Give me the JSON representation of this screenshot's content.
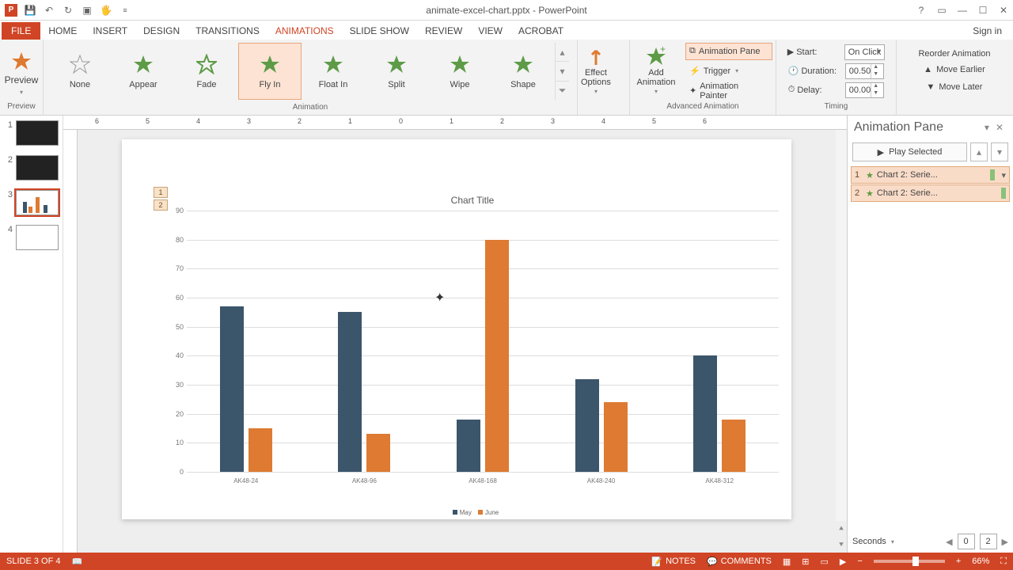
{
  "app": {
    "title": "animate-excel-chart.pptx - PowerPoint",
    "signin": "Sign in"
  },
  "tabs": {
    "file": "FILE",
    "home": "HOME",
    "insert": "INSERT",
    "design": "DESIGN",
    "transitions": "TRANSITIONS",
    "animations": "ANIMATIONS",
    "slideshow": "SLIDE SHOW",
    "review": "REVIEW",
    "view": "VIEW",
    "acrobat": "ACROBAT"
  },
  "ribbon": {
    "preview": {
      "btn": "Preview",
      "group": "Preview"
    },
    "animation": {
      "group": "Animation",
      "items": {
        "none": "None",
        "appear": "Appear",
        "fade": "Fade",
        "flyin": "Fly In",
        "floatin": "Float In",
        "split": "Split",
        "wipe": "Wipe",
        "shape": "Shape"
      }
    },
    "effect_options": "Effect\nOptions",
    "advanced": {
      "group": "Advanced Animation",
      "add": "Add\nAnimation",
      "pane": "Animation Pane",
      "trigger": "Trigger",
      "painter": "Animation Painter"
    },
    "timing": {
      "group": "Timing",
      "start_lbl": "Start:",
      "start_val": "On Click",
      "duration_lbl": "Duration:",
      "duration_val": "00.50",
      "delay_lbl": "Delay:",
      "delay_val": "00.00"
    },
    "reorder": {
      "title": "Reorder Animation",
      "earlier": "Move Earlier",
      "later": "Move Later"
    }
  },
  "ruler": {
    "h": [
      "6",
      "5",
      "4",
      "3",
      "2",
      "1",
      "0",
      "1",
      "2",
      "3",
      "4",
      "5",
      "6"
    ]
  },
  "anim_badges": [
    "1",
    "2"
  ],
  "chart_data": {
    "type": "bar",
    "title": "Chart Title",
    "categories": [
      "AK48-24",
      "AK48-96",
      "AK48-168",
      "AK48-240",
      "AK48-312"
    ],
    "series": [
      {
        "name": "May",
        "color": "#3b556b",
        "values": [
          57,
          55,
          18,
          32,
          40
        ]
      },
      {
        "name": "June",
        "color": "#de7a31",
        "values": [
          15,
          13,
          80,
          24,
          18
        ]
      }
    ],
    "ylim": [
      0,
      90
    ],
    "yticks": [
      0,
      10,
      20,
      30,
      40,
      50,
      60,
      70,
      80,
      90
    ],
    "xlabel": "",
    "ylabel": ""
  },
  "animpane": {
    "title": "Animation Pane",
    "play": "Play Selected",
    "items": [
      {
        "n": "1",
        "label": "Chart 2: Serie..."
      },
      {
        "n": "2",
        "label": "Chart 2: Serie..."
      }
    ],
    "seconds": "Seconds",
    "sec_a": "0",
    "sec_b": "2"
  },
  "status": {
    "slide": "SLIDE 3 OF 4",
    "notes": "NOTES",
    "comments": "COMMENTS",
    "zoom": "66%"
  }
}
